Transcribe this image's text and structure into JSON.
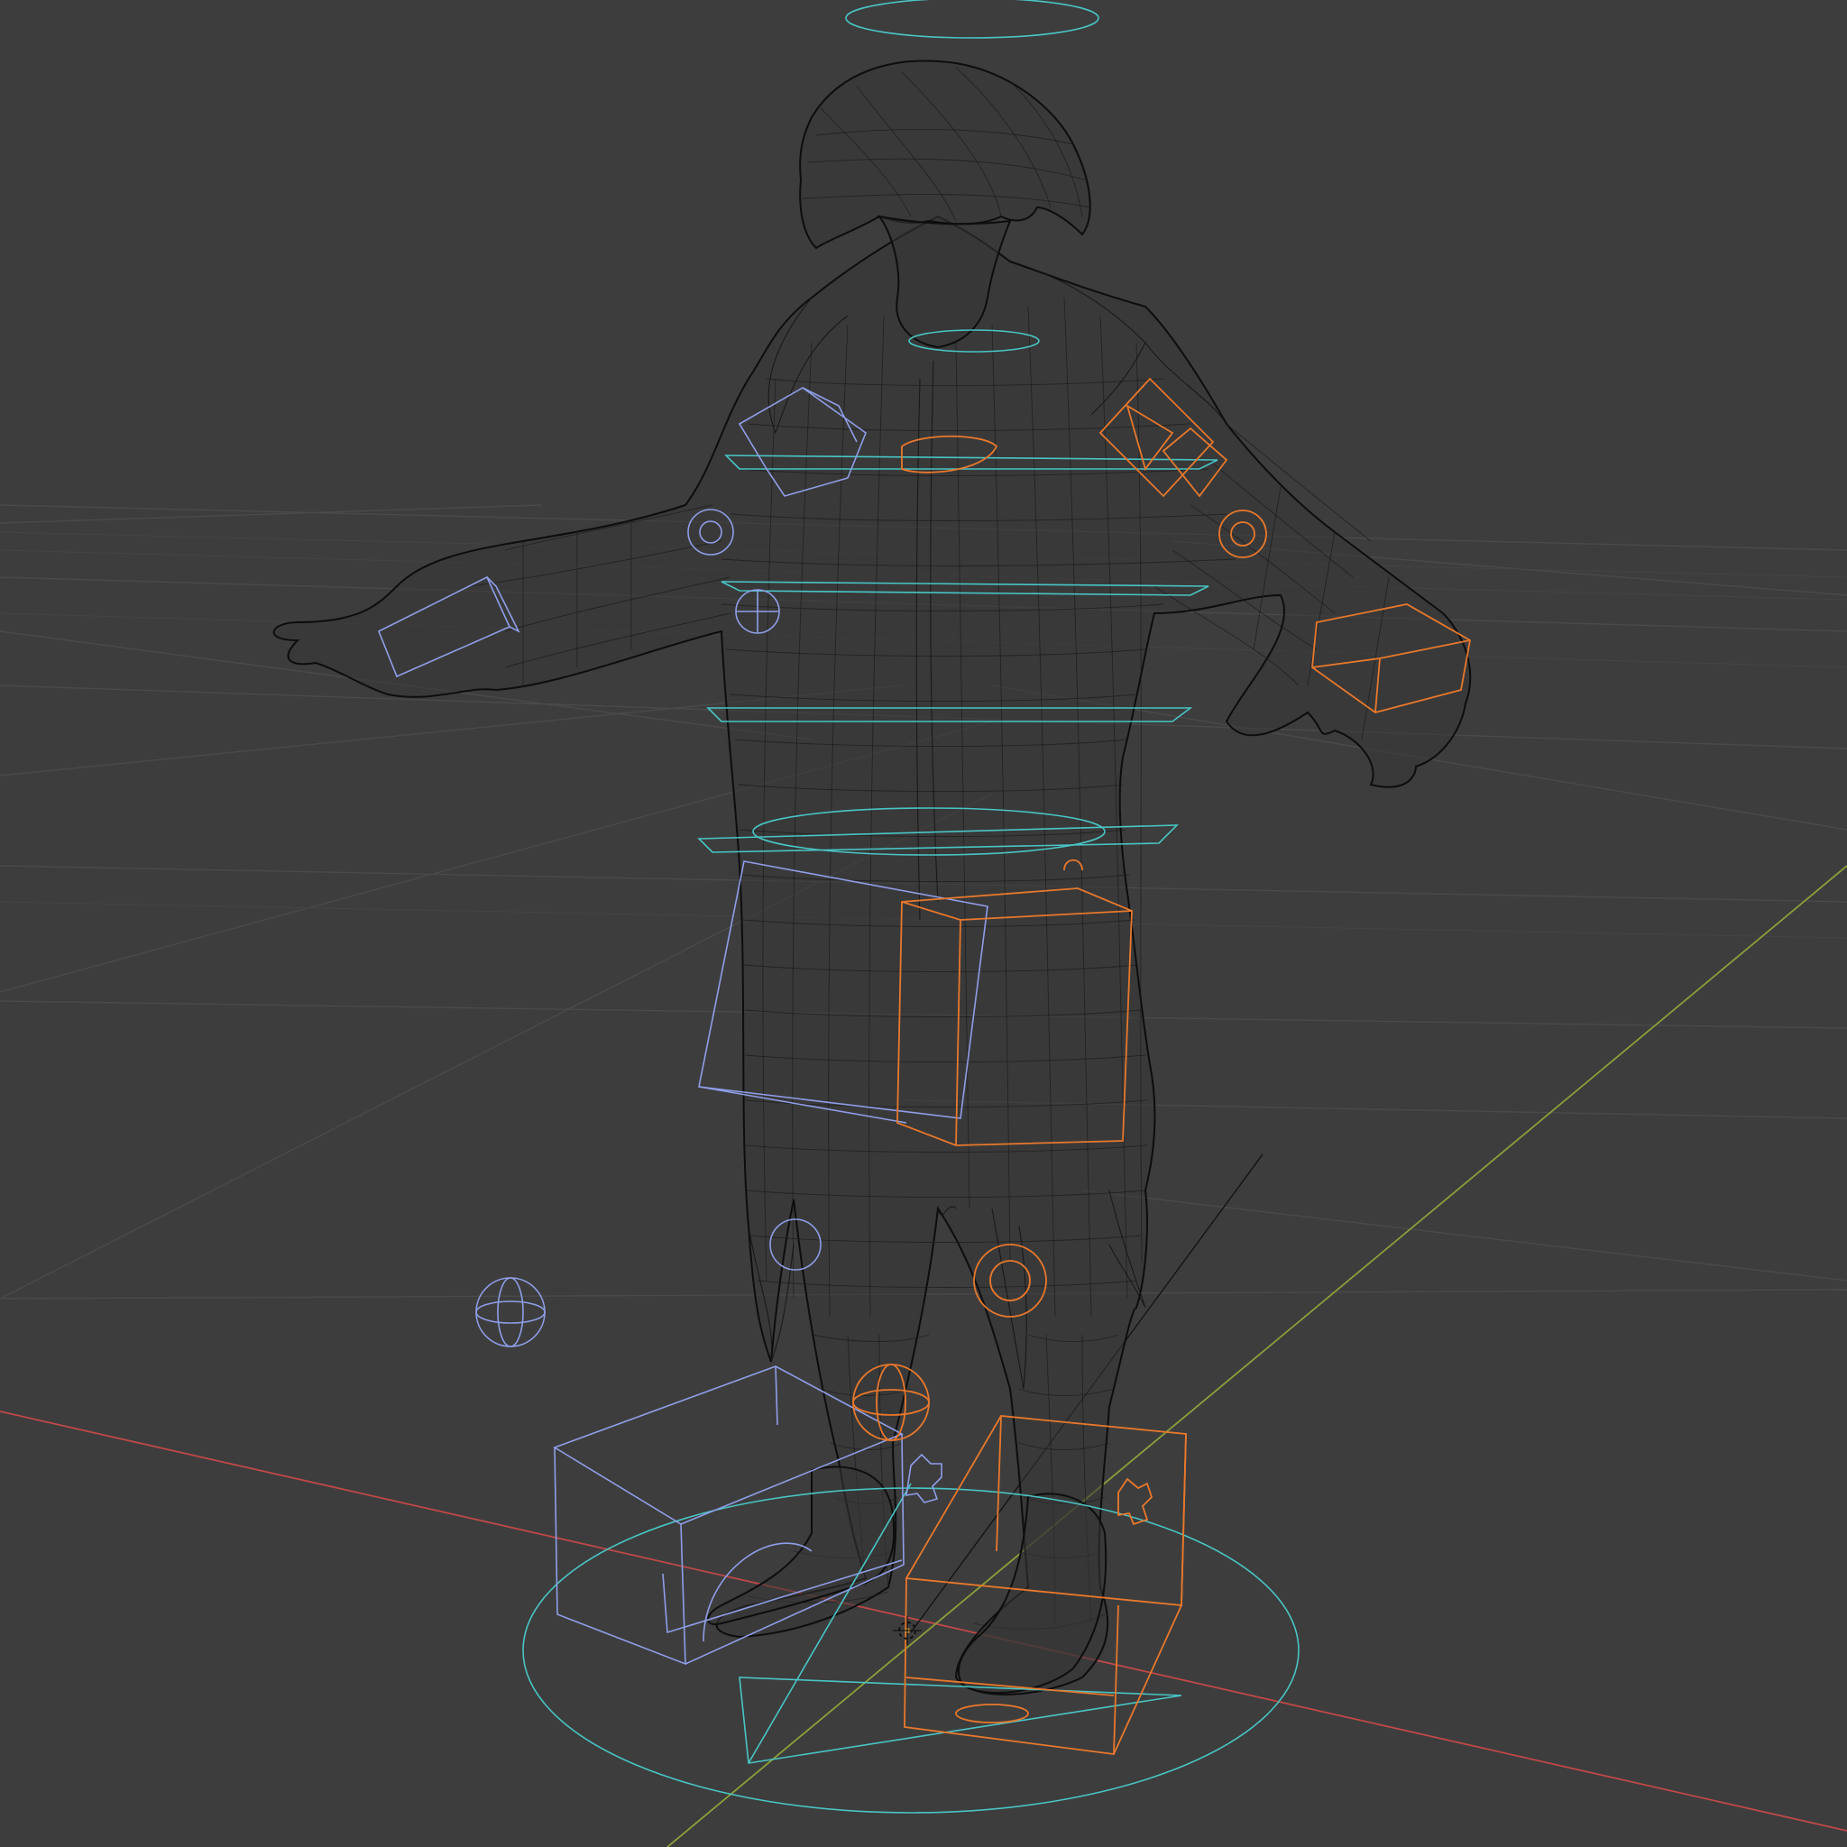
{
  "viewport": {
    "mode": "wireframe",
    "shading": "wireframe",
    "object": "rigged-character-mesh",
    "colors": {
      "background": "#3d3d3d",
      "grid": "#4a4a4a",
      "x_axis": "#c04848",
      "y_axis": "#8aa03a",
      "mesh_wire": "#141414",
      "rig_center": "#49c5c5",
      "rig_left": "#8f9ee8",
      "rig_right": "#e8782c"
    }
  }
}
